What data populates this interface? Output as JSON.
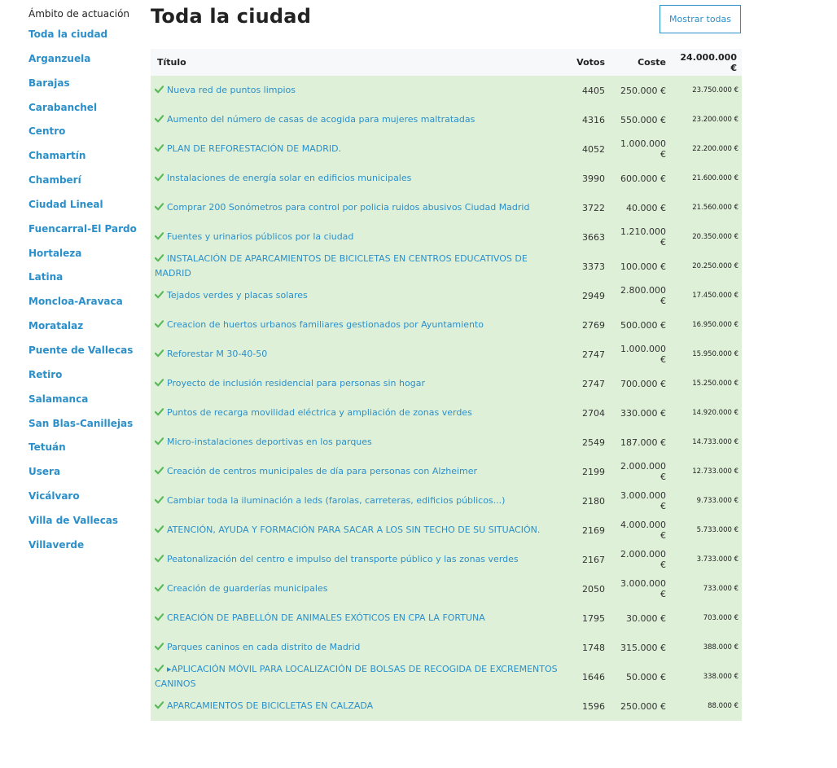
{
  "sidebar": {
    "heading": "Ámbito de actuación",
    "items": [
      {
        "label": "Toda la ciudad"
      },
      {
        "label": "Arganzuela"
      },
      {
        "label": "Barajas"
      },
      {
        "label": "Carabanchel"
      },
      {
        "label": "Centro"
      },
      {
        "label": "Chamartín"
      },
      {
        "label": "Chamberí"
      },
      {
        "label": "Ciudad Lineal"
      },
      {
        "label": "Fuencarral-El Pardo"
      },
      {
        "label": "Hortaleza"
      },
      {
        "label": "Latina"
      },
      {
        "label": "Moncloa-Aravaca"
      },
      {
        "label": "Moratalaz"
      },
      {
        "label": "Puente de Vallecas"
      },
      {
        "label": "Retiro"
      },
      {
        "label": "Salamanca"
      },
      {
        "label": "San Blas-Canillejas"
      },
      {
        "label": "Tetuán"
      },
      {
        "label": "Usera"
      },
      {
        "label": "Vicálvaro"
      },
      {
        "label": "Villa de Vallecas"
      },
      {
        "label": "Villaverde"
      }
    ]
  },
  "page": {
    "title": "Toda la ciudad",
    "show_all_label": "Mostrar todas"
  },
  "table": {
    "headers": {
      "title": "Título",
      "votes": "Votos",
      "cost": "Coste",
      "total": "24.000.000 €"
    },
    "accent_color": "#2b8fc9",
    "row_color": "#dff0d8",
    "check_color": "#5cb85c",
    "rows": [
      {
        "title": "Nueva red de puntos limpios",
        "votes": "4405",
        "cost": "250.000 €",
        "remaining": "23.750.000 €"
      },
      {
        "title": "Aumento del número de casas de acogida para mujeres maltratadas",
        "votes": "4316",
        "cost": "550.000 €",
        "remaining": "23.200.000 €"
      },
      {
        "title": "PLAN DE REFORESTACIÓN DE MADRID.",
        "votes": "4052",
        "cost": "1.000.000 €",
        "remaining": "22.200.000 €"
      },
      {
        "title": "Instalaciones de energía solar en edificios municipales",
        "votes": "3990",
        "cost": "600.000 €",
        "remaining": "21.600.000 €"
      },
      {
        "title": "Comprar 200 Sonómetros para control por policia ruidos abusivos Ciudad Madrid",
        "votes": "3722",
        "cost": "40.000 €",
        "remaining": "21.560.000 €"
      },
      {
        "title": "Fuentes y urinarios públicos por la ciudad",
        "votes": "3663",
        "cost": "1.210.000 €",
        "remaining": "20.350.000 €"
      },
      {
        "title": "INSTALACIÓN DE APARCAMIENTOS DE BICICLETAS EN CENTROS EDUCATIVOS DE MADRID",
        "votes": "3373",
        "cost": "100.000 €",
        "remaining": "20.250.000 €"
      },
      {
        "title": "Tejados verdes y placas solares",
        "votes": "2949",
        "cost": "2.800.000 €",
        "remaining": "17.450.000 €"
      },
      {
        "title": "Creacion de huertos urbanos familiares gestionados por Ayuntamiento",
        "votes": "2769",
        "cost": "500.000 €",
        "remaining": "16.950.000 €"
      },
      {
        "title": "Reforestar M 30-40-50",
        "votes": "2747",
        "cost": "1.000.000 €",
        "remaining": "15.950.000 €"
      },
      {
        "title": "Proyecto de inclusión residencial para personas sin hogar",
        "votes": "2747",
        "cost": "700.000 €",
        "remaining": "15.250.000 €"
      },
      {
        "title": "Puntos de recarga movilidad eléctrica y ampliación de zonas verdes",
        "votes": "2704",
        "cost": "330.000 €",
        "remaining": "14.920.000 €"
      },
      {
        "title": "Micro-instalaciones deportivas en los parques",
        "votes": "2549",
        "cost": "187.000 €",
        "remaining": "14.733.000 €"
      },
      {
        "title": "Creación de centros municipales de día para personas con Alzheimer",
        "votes": "2199",
        "cost": "2.000.000 €",
        "remaining": "12.733.000 €"
      },
      {
        "title": "Cambiar toda la iluminación a leds (farolas, carreteras, edificios públicos...)",
        "votes": "2180",
        "cost": "3.000.000 €",
        "remaining": "9.733.000 €"
      },
      {
        "title": "ATENCIÓN, AYUDA Y FORMACIÓN PARA SACAR A LOS SIN TECHO DE SU SITUACIÓN.",
        "votes": "2169",
        "cost": "4.000.000 €",
        "remaining": "5.733.000 €"
      },
      {
        "title": "Peatonalización del centro e impulso del transporte público y las zonas verdes",
        "votes": "2167",
        "cost": "2.000.000 €",
        "remaining": "3.733.000 €"
      },
      {
        "title": "Creación de guarderías municipales",
        "votes": "2050",
        "cost": "3.000.000 €",
        "remaining": "733.000 €"
      },
      {
        "title": "CREACIÓN DE PABELLÓN DE ANIMALES EXÓTICOS EN CPA LA FORTUNA",
        "votes": "1795",
        "cost": "30.000 €",
        "remaining": "703.000 €"
      },
      {
        "title": "Parques caninos en cada distrito de Madrid",
        "votes": "1748",
        "cost": "315.000 €",
        "remaining": "388.000 €"
      },
      {
        "title": "▸APLICACIÓN MÓVIL PARA LOCALIZACIÓN DE BOLSAS DE RECOGIDA DE EXCREMENTOS CANINOS",
        "votes": "1646",
        "cost": "50.000 €",
        "remaining": "338.000 €"
      },
      {
        "title": "APARCAMIENTOS DE BICICLETAS EN CALZADA",
        "votes": "1596",
        "cost": "250.000 €",
        "remaining": "88.000 €"
      }
    ]
  }
}
